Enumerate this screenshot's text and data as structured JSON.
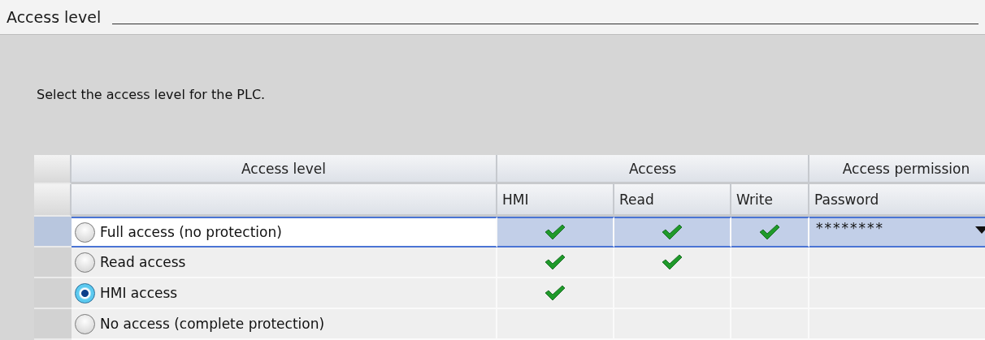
{
  "section": {
    "title": "Access level"
  },
  "instruction": "Select the access level for the PLC.",
  "table": {
    "column_groups": [
      {
        "label": "Access level"
      },
      {
        "label": "Access",
        "columns": [
          "HMI",
          "Read",
          "Write"
        ]
      },
      {
        "label": "Access permission",
        "columns": [
          "Password"
        ]
      }
    ],
    "rows": [
      {
        "label": "Full access (no protection)",
        "selected": false,
        "focused": true,
        "hmi": true,
        "read": true,
        "write": true,
        "password": "********"
      },
      {
        "label": "Read access",
        "selected": false,
        "focused": false,
        "hmi": true,
        "read": true,
        "write": false
      },
      {
        "label": "HMI access",
        "selected": true,
        "focused": false,
        "hmi": true,
        "read": false,
        "write": false
      },
      {
        "label": "No access (complete protection)",
        "selected": false,
        "focused": false,
        "hmi": false,
        "read": false,
        "write": false
      }
    ]
  }
}
